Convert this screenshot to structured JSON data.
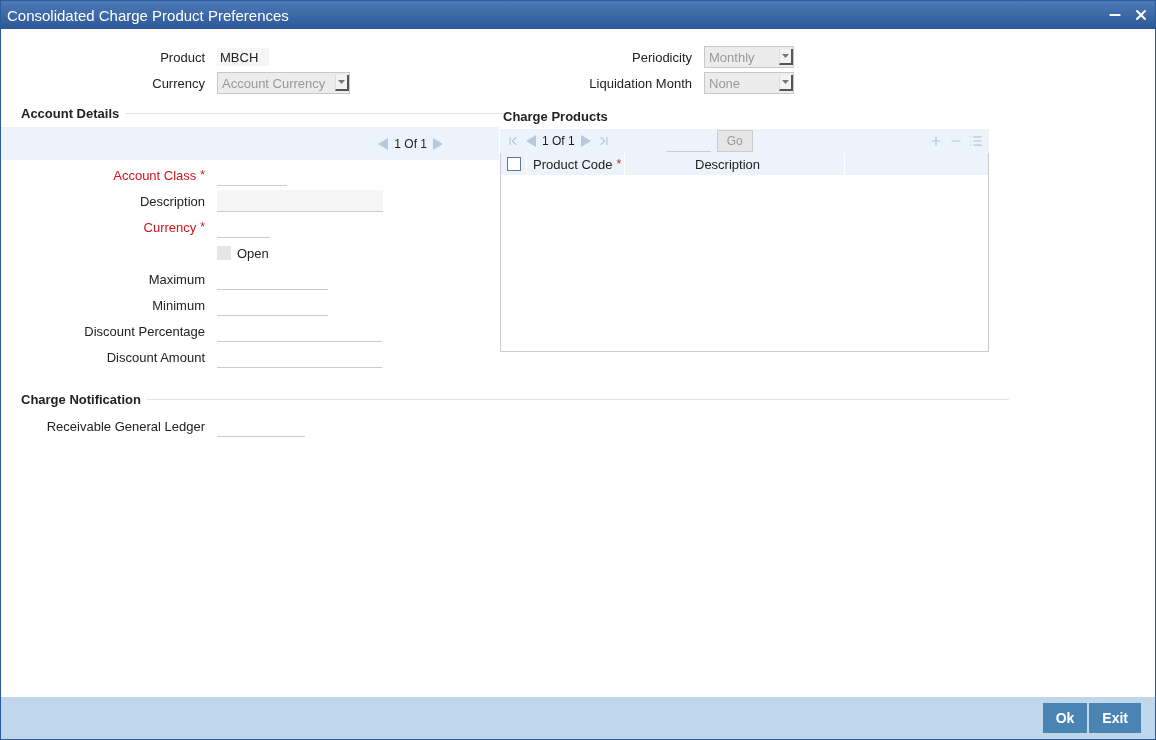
{
  "window": {
    "title": "Consolidated Charge Product Preferences"
  },
  "header_left": [
    {
      "label": "Product",
      "kind": "text",
      "value": "MBCH"
    },
    {
      "label": "Currency",
      "kind": "select",
      "value": "Account Currency",
      "disabled": true
    }
  ],
  "header_right": [
    {
      "label": "Periodicity",
      "kind": "select",
      "value": "Monthly",
      "disabled": true
    },
    {
      "label": "Liquidation Month",
      "kind": "select",
      "value": "None",
      "disabled": true
    }
  ],
  "account_details": {
    "title": "Account Details",
    "pager": "1 Of 1",
    "fields": [
      {
        "label": "Account Class",
        "kind": "text",
        "required_mark": "*"
      },
      {
        "label": "Description",
        "kind": "readonly"
      },
      {
        "label": "Currency",
        "kind": "text",
        "required_mark": "*"
      },
      {
        "label": "Open",
        "kind": "checkbox",
        "checked": false
      },
      {
        "label": "Maximum",
        "kind": "text"
      },
      {
        "label": "Minimum",
        "kind": "text"
      },
      {
        "label": "Discount Percentage",
        "kind": "text"
      },
      {
        "label": "Discount Amount",
        "kind": "text"
      }
    ]
  },
  "charge_products": {
    "title": "Charge Products",
    "pager": "1 Of 1",
    "go": "Go",
    "columns": [
      {
        "label": "Product Code",
        "required_mark": "*"
      },
      {
        "label": "Description"
      }
    ],
    "select_all_checked": false
  },
  "charge_notification": {
    "title": "Charge Notification",
    "fields": [
      {
        "label": "Receivable General Ledger"
      }
    ]
  },
  "buttons": [
    "Ok",
    "Exit"
  ]
}
